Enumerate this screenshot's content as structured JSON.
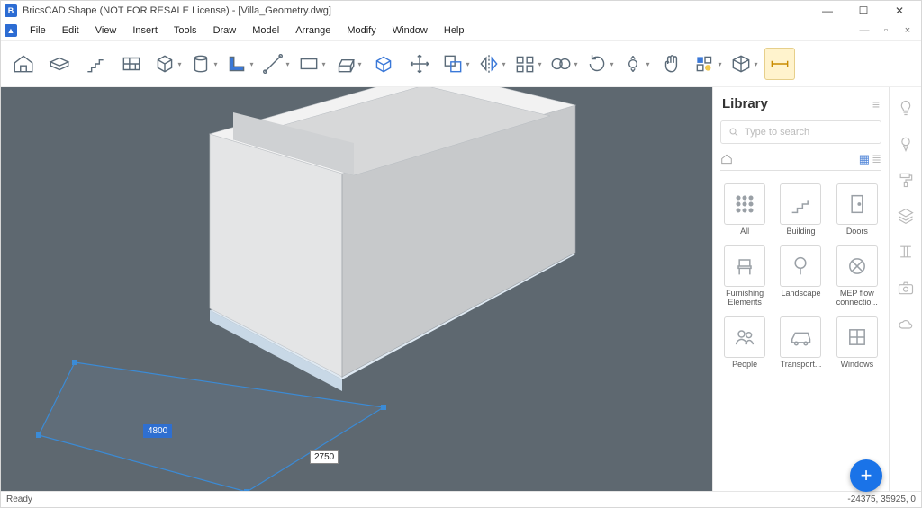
{
  "title": "BricsCAD Shape (NOT FOR RESALE License) - [Villa_Geometry.dwg]",
  "app_icon_letter": "B",
  "menu": {
    "items": [
      "File",
      "Edit",
      "View",
      "Insert",
      "Tools",
      "Draw",
      "Model",
      "Arrange",
      "Modify",
      "Window",
      "Help"
    ]
  },
  "doc_controls": {
    "min": "—",
    "restore": "▫",
    "close": "×"
  },
  "win_controls": {
    "min": "—",
    "max": "☐",
    "close": "✕"
  },
  "toolbar": {
    "items": [
      {
        "name": "home-icon",
        "label": "Home"
      },
      {
        "name": "slab-icon",
        "label": "Slab"
      },
      {
        "name": "stairs-icon",
        "label": "Stairs"
      },
      {
        "name": "wall-icon",
        "label": "Wall"
      },
      {
        "name": "box-icon",
        "label": "Box",
        "drop": true
      },
      {
        "name": "column-icon",
        "label": "Column",
        "drop": true
      },
      {
        "name": "profile-icon",
        "label": "Profile",
        "drop": true
      },
      {
        "name": "line-icon",
        "label": "Line",
        "drop": true
      },
      {
        "name": "rect-icon",
        "label": "Rectangle",
        "drop": true
      },
      {
        "name": "extrude-icon",
        "label": "Extrude",
        "drop": true
      },
      {
        "name": "pushpull-icon",
        "label": "PushPull"
      },
      {
        "name": "move-icon",
        "label": "Move"
      },
      {
        "name": "copy-icon",
        "label": "Copy",
        "drop": true
      },
      {
        "name": "mirror-icon",
        "label": "Mirror",
        "drop": true
      },
      {
        "name": "align-icon",
        "label": "Align",
        "drop": true
      },
      {
        "name": "array-icon",
        "label": "Array",
        "drop": true
      },
      {
        "name": "rotate-icon",
        "label": "Rotate",
        "drop": true
      },
      {
        "name": "orbit-icon",
        "label": "Orbit",
        "drop": true
      },
      {
        "name": "pan-icon",
        "label": "Pan"
      },
      {
        "name": "visual-icon",
        "label": "Visual",
        "drop": true
      },
      {
        "name": "section-icon",
        "label": "Section",
        "drop": true
      },
      {
        "name": "measure-icon",
        "label": "Measure",
        "selected": true
      }
    ]
  },
  "library": {
    "title": "Library",
    "search_placeholder": "Type to search",
    "categories": [
      {
        "name": "All"
      },
      {
        "name": "Building"
      },
      {
        "name": "Doors"
      },
      {
        "name": "Furnishing Elements"
      },
      {
        "name": "Landscape"
      },
      {
        "name": "MEP flow connectio..."
      },
      {
        "name": "People"
      },
      {
        "name": "Transport..."
      },
      {
        "name": "Windows"
      }
    ]
  },
  "rail": {
    "items": [
      {
        "name": "lightbulb-icon"
      },
      {
        "name": "balloon-icon"
      },
      {
        "name": "paintroller-icon"
      },
      {
        "name": "layers-icon"
      },
      {
        "name": "ibeam-icon"
      },
      {
        "name": "camera-icon"
      },
      {
        "name": "cloud-icon"
      }
    ]
  },
  "viewport": {
    "dim_a": "4800",
    "dim_b": "2750"
  },
  "status": {
    "left": "Ready",
    "right": "-24375, 35925, 0"
  },
  "fab": "+"
}
